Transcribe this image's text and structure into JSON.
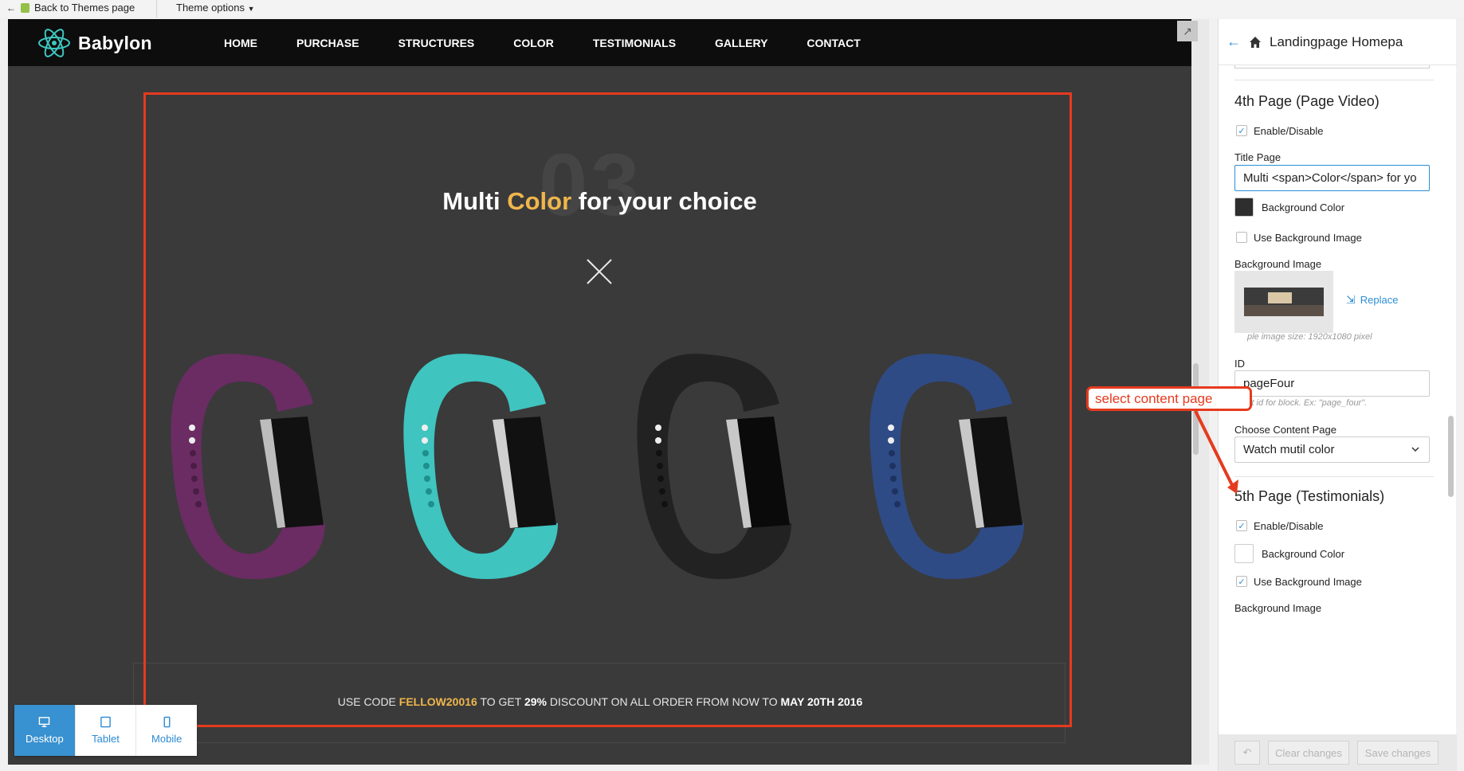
{
  "admin_bar": {
    "back_label": "Back to Themes page",
    "theme_options_label": "Theme options"
  },
  "site": {
    "logo_text": "Babylon",
    "menu": [
      "HOME",
      "PURCHASE",
      "STRUCTURES",
      "COLOR",
      "TESTIMONIALS",
      "GALLERY",
      "CONTACT"
    ],
    "background_number": "03",
    "headline_before": "Multi ",
    "headline_highlight": "Color",
    "headline_after": " for your choice",
    "promo_prefix": "USE CODE ",
    "promo_code": "FELLOW20016",
    "promo_mid": " TO GET ",
    "promo_percent": "29%",
    "promo_mid2": " DISCOUNT ON ALL ORDER FROM NOW TO ",
    "promo_date": "MAY 20TH 2016",
    "band_colors": [
      "#6a2c63",
      "#3fc4c0",
      "#2b2b2b",
      "#2f4b86"
    ],
    "highlight_color": "#f0b64c"
  },
  "device_switcher": {
    "items": [
      "Desktop",
      "Tablet",
      "Mobile"
    ],
    "active": "Desktop"
  },
  "panel": {
    "title": "Landingpage Homepa",
    "page4": {
      "heading": "4th Page (Page Video)",
      "enable_label": "Enable/Disable",
      "title_page_label": "Title Page",
      "title_page_value": "Multi <span>Color</span> for yo",
      "bg_color_label": "Background Color",
      "use_bg_image_label": "Use Background Image",
      "bg_image_label": "Background Image",
      "replace_label": "Replace",
      "image_hint": "ple image size: 1920x1080 pixel",
      "id_label": "ID",
      "id_value": "pageFour",
      "id_hint": "Input id for block. Ex: \"page_four\".",
      "choose_label": "Choose Content Page",
      "choose_value": "Watch mutil color"
    },
    "page5": {
      "heading": "5th Page (Testimonials)",
      "enable_label": "Enable/Disable",
      "bg_color_label": "Background Color",
      "use_bg_image_label": "Use Background Image",
      "bg_image_label": "Background Image"
    },
    "footer": {
      "clear_label": "Clear changes",
      "save_label": "Save changes"
    }
  },
  "annotation": {
    "text": "select content page",
    "color": "#e63a1e"
  }
}
